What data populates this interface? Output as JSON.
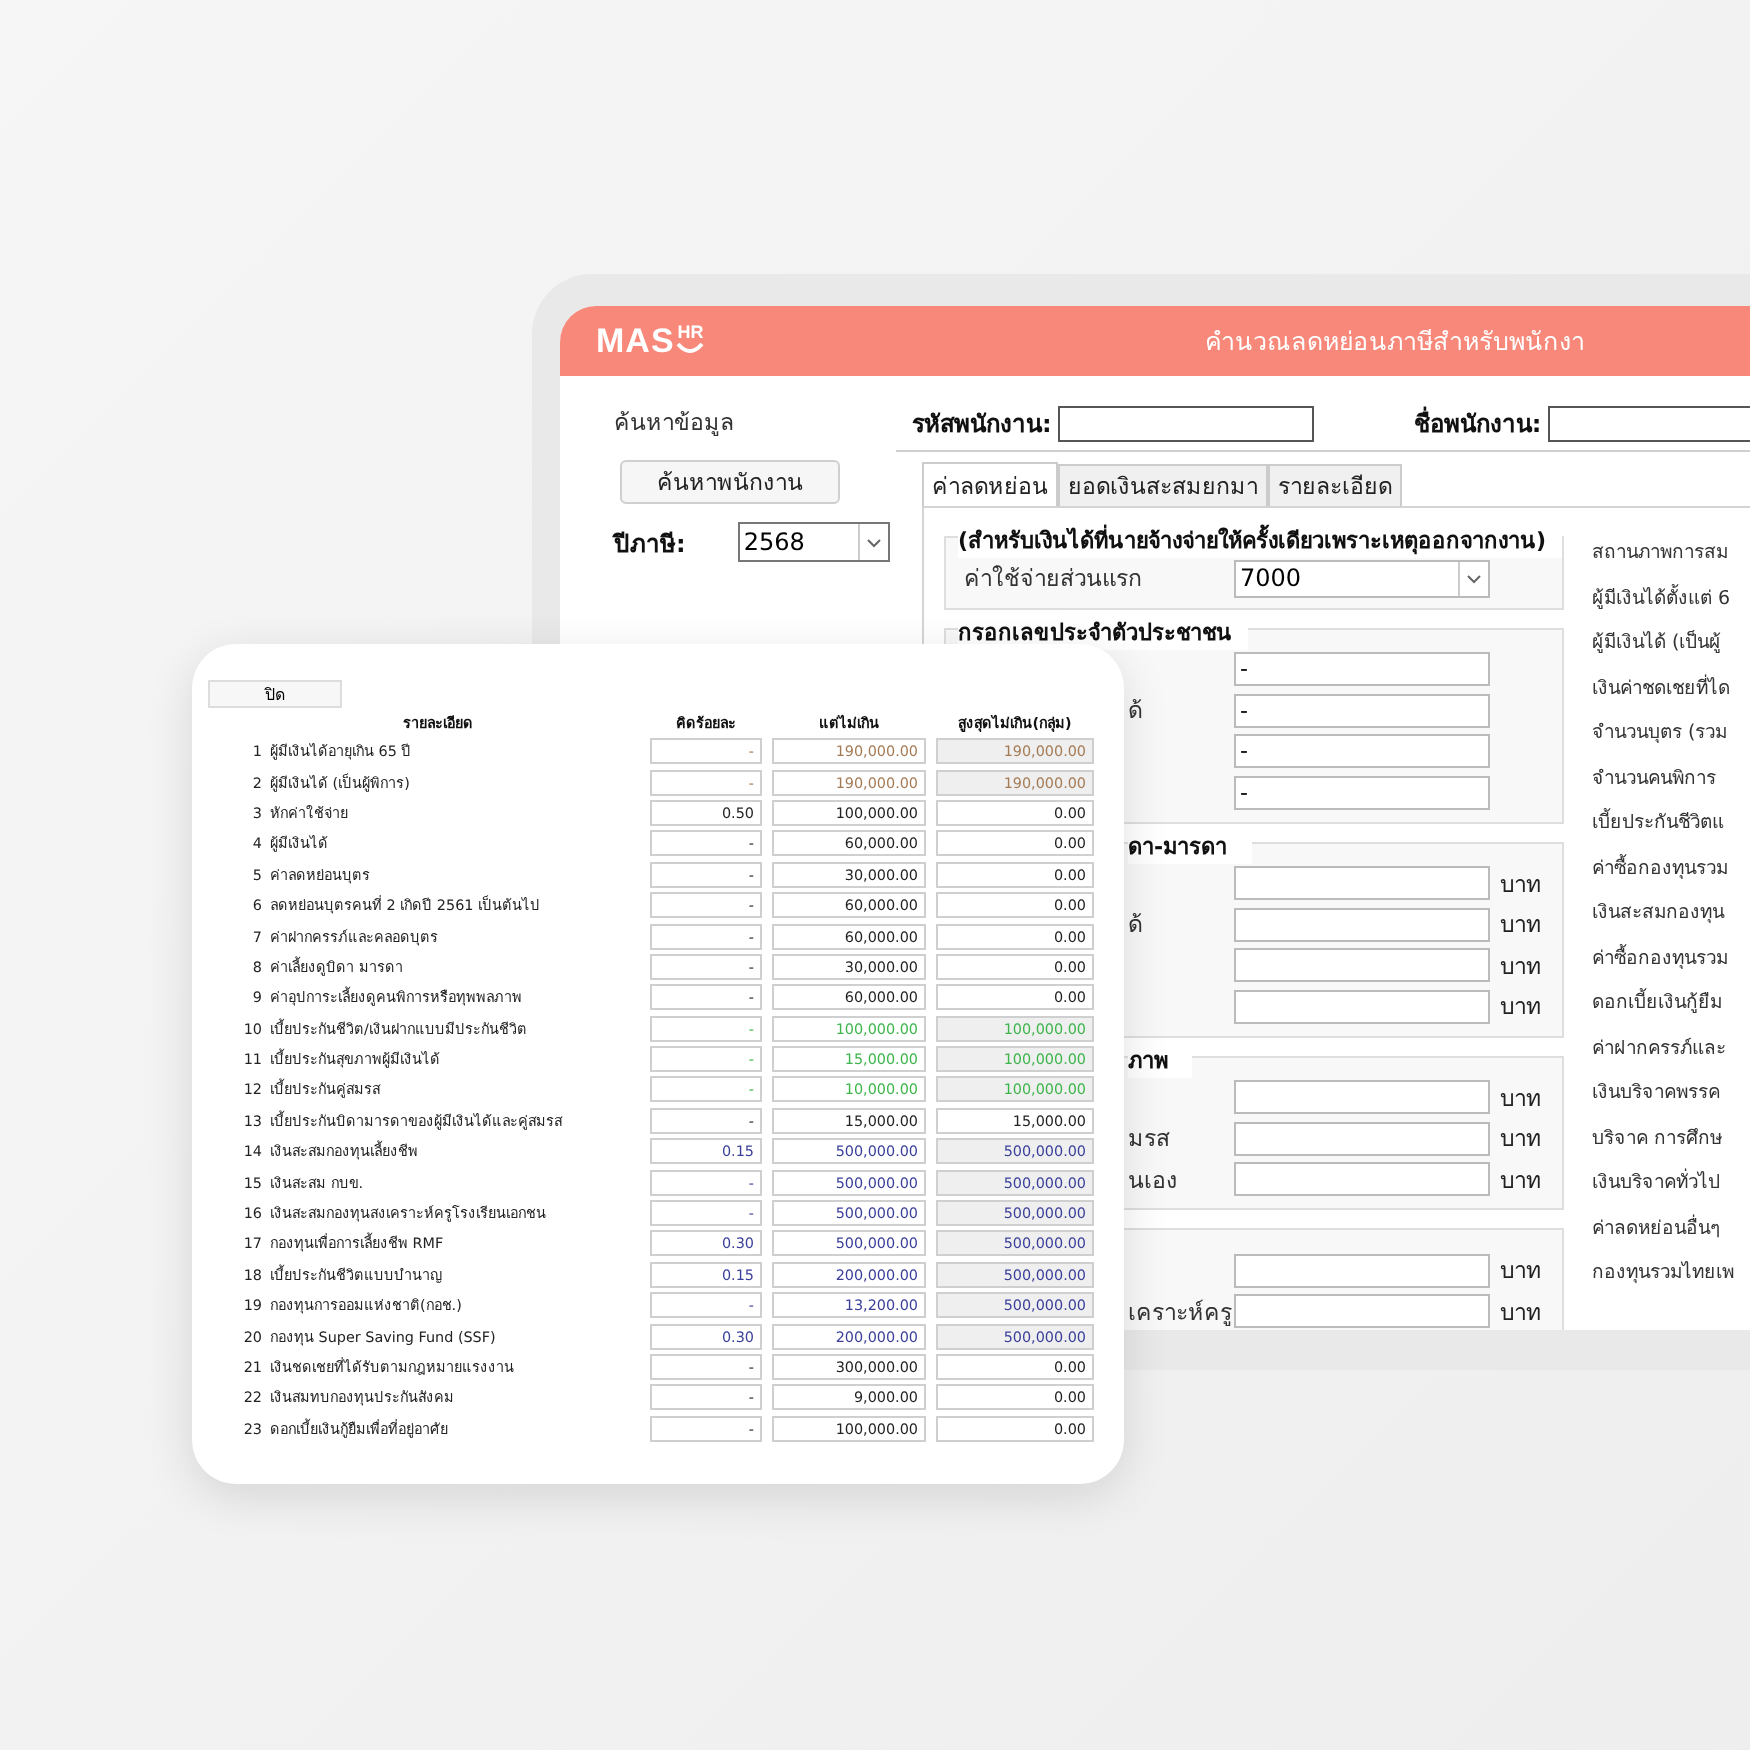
{
  "back_window": {
    "logo": {
      "main": "MAS",
      "sup": "HR"
    },
    "title": "คำนวณลดหย่อนภาษีสำหรับพนักงา",
    "search": {
      "heading": "ค้นหาข้อมูล",
      "button": "ค้นหาพนักงาน",
      "year_label": "ปีภาษี:",
      "year_value": "2568"
    },
    "employee_id_label": "รหัสพนักงาน:",
    "employee_name_label": "ชื่อพนักงาน:",
    "tabs": [
      {
        "label": "ค่าลดหย่อน",
        "selected": true
      },
      {
        "label": "ยอดเงินสะสมยกมา",
        "selected": false
      },
      {
        "label": "รายละเอียด",
        "selected": false
      }
    ],
    "groups": [
      {
        "title": "(สำหรับเงินได้ที่นายจ้างจ่ายให้ครั้งเดียวเพราะเหตุออกจากงาน)",
        "title_cut": false,
        "label_cut": false,
        "rows": [
          {
            "kind": "dropdown",
            "label": "ค่าใช้จ่ายส่วนแรก",
            "value": "7000"
          }
        ]
      },
      {
        "title": "กรอกเลขประจำตัวประชาชน",
        "title_cut": false,
        "label_cut": true,
        "rows": [
          {
            "kind": "input",
            "value": "-"
          },
          {
            "kind": "input",
            "label": "ด้",
            "value": "-"
          },
          {
            "kind": "input",
            "value": "-"
          },
          {
            "kind": "input",
            "value": "-"
          }
        ]
      },
      {
        "title": "ดา-มารดา",
        "title_cut": true,
        "label_cut": true,
        "rows": [
          {
            "kind": "input",
            "unit": "บาท"
          },
          {
            "kind": "input",
            "label": "ด้",
            "unit": "บาท"
          },
          {
            "kind": "input",
            "unit": "บาท"
          },
          {
            "kind": "input",
            "unit": "บาท"
          }
        ]
      },
      {
        "title": "ภาพ",
        "title_cut": true,
        "label_cut": true,
        "rows": [
          {
            "kind": "input",
            "unit": "บาท"
          },
          {
            "kind": "input",
            "label": "มรส",
            "unit": "บาท"
          },
          {
            "kind": "input",
            "label": "นเอง",
            "unit": "บาท"
          }
        ]
      },
      {
        "label_cut": true,
        "rows": [
          {
            "kind": "input",
            "unit": "บาท"
          },
          {
            "kind": "input",
            "label": "เคราะห์ครู",
            "unit": "บาท"
          }
        ]
      }
    ],
    "summary_labels": [
      "สถานภาพการสม",
      "ผู้มีเงินได้ตั้งแต่ 6",
      "ผู้มีเงินได้ (เป็นผู้",
      "เงินค่าชดเชยที่ได",
      "จำนวนบุตร (รวม",
      "จำนวนคนพิการ",
      "เบี้ยประกันชีวิตแ",
      "ค่าซื้อกองทุนรวม",
      "เงินสะสมกองทุน",
      "ค่าซื้อกองทุนรวม",
      "ดอกเบี้ยเงินกู้ยืม",
      "ค่าฝากครรภ์และ",
      "เงินบริจาคพรรค",
      "บริจาค การศึกษ",
      "เงินบริจาคทั่วไป",
      "ค่าลดหย่อนอื่นๆ",
      "กองทุนรวมไทยเพ"
    ]
  },
  "detail_card": {
    "close_button": "ปิด",
    "columns": [
      "รายละเอียด",
      "คิดร้อยละ",
      "แต่ไม่เกิน",
      "สูงสุดไม่เกิน(กลุ่ม)"
    ],
    "rows": [
      {
        "no": "1",
        "label": "ผู้มีเงินได้อายุเกิน 65 ปี",
        "percent": "-",
        "limit": "190,000.00",
        "max": "190,000.00",
        "color": "#a47a55",
        "max_shaded": true
      },
      {
        "no": "2",
        "label": "ผู้มีเงินได้ (เป็นผู้พิการ)",
        "percent": "-",
        "limit": "190,000.00",
        "max": "190,000.00",
        "color": "#a47a55",
        "max_shaded": true
      },
      {
        "no": "3",
        "label": "หักค่าใช้จ่าย",
        "percent": "0.50",
        "limit": "100,000.00",
        "max": "0.00",
        "color": "#222222",
        "max_shaded": false
      },
      {
        "no": "4",
        "label": "ผู้มีเงินได้",
        "percent": "-",
        "limit": "60,000.00",
        "max": "0.00",
        "color": "#222222",
        "max_shaded": false
      },
      {
        "no": "5",
        "label": "ค่าลดหย่อนบุตร",
        "percent": "-",
        "limit": "30,000.00",
        "max": "0.00",
        "color": "#222222",
        "max_shaded": false
      },
      {
        "no": "6",
        "label": "ลดหย่อนบุตรคนที่ 2 เกิดปี 2561 เป็นต้นไป",
        "percent": "-",
        "limit": "60,000.00",
        "max": "0.00",
        "color": "#222222",
        "max_shaded": false
      },
      {
        "no": "7",
        "label": "ค่าฝากครรภ์และคลอดบุตร",
        "percent": "-",
        "limit": "60,000.00",
        "max": "0.00",
        "color": "#222222",
        "max_shaded": false
      },
      {
        "no": "8",
        "label": "ค่าเลี้ยงดูบิดา มารดา",
        "percent": "-",
        "limit": "30,000.00",
        "max": "0.00",
        "color": "#222222",
        "max_shaded": false
      },
      {
        "no": "9",
        "label": "ค่าอุปการะเลี้ยงดูคนพิการหรือทุพพลภาพ",
        "percent": "-",
        "limit": "60,000.00",
        "max": "0.00",
        "color": "#222222",
        "max_shaded": false
      },
      {
        "no": "10",
        "label": "เบี้ยประกันชีวิต/เงินฝากแบบมีประกันชีวิต",
        "percent": "-",
        "limit": "100,000.00",
        "max": "100,000.00",
        "color": "#3cb54a",
        "max_shaded": true
      },
      {
        "no": "11",
        "label": "เบี้ยประกันสุขภาพผู้มีเงินได้",
        "percent": "-",
        "limit": "15,000.00",
        "max": "100,000.00",
        "color": "#3cb54a",
        "max_shaded": true
      },
      {
        "no": "12",
        "label": "เบี้ยประกันคู่สมรส",
        "percent": "-",
        "limit": "10,000.00",
        "max": "100,000.00",
        "color": "#3cb54a",
        "max_shaded": true
      },
      {
        "no": "13",
        "label": "เบี้ยประกันบิดามารดาของผู้มีเงินได้และคู่สมรส",
        "percent": "-",
        "limit": "15,000.00",
        "max": "15,000.00",
        "color": "#222222",
        "max_shaded": false
      },
      {
        "no": "14",
        "label": "เงินสะสมกองทุนเลี้ยงชีพ",
        "percent": "0.15",
        "limit": "500,000.00",
        "max": "500,000.00",
        "color": "#3a3f9a",
        "max_shaded": true
      },
      {
        "no": "15",
        "label": "เงินสะสม กบข.",
        "percent": "-",
        "limit": "500,000.00",
        "max": "500,000.00",
        "color": "#3a3f9a",
        "max_shaded": true
      },
      {
        "no": "16",
        "label": "เงินสะสมกองทุนสงเคราะห์ครูโรงเรียนเอกชน",
        "percent": "-",
        "limit": "500,000.00",
        "max": "500,000.00",
        "color": "#3a3f9a",
        "max_shaded": true
      },
      {
        "no": "17",
        "label": "กองทุนเพื่อการเลี้ยงชีพ RMF",
        "percent": "0.30",
        "limit": "500,000.00",
        "max": "500,000.00",
        "color": "#3a3f9a",
        "max_shaded": true
      },
      {
        "no": "18",
        "label": "เบี้ยประกันชีวิตแบบบำนาญ",
        "percent": "0.15",
        "limit": "200,000.00",
        "max": "500,000.00",
        "color": "#3a3f9a",
        "max_shaded": true
      },
      {
        "no": "19",
        "label": "กองทุนการออมแห่งชาติ(กอช.)",
        "percent": "-",
        "limit": "13,200.00",
        "max": "500,000.00",
        "color": "#3a3f9a",
        "max_shaded": true
      },
      {
        "no": "20",
        "label": "กองทุน Super Saving Fund (SSF)",
        "percent": "0.30",
        "limit": "200,000.00",
        "max": "500,000.00",
        "color": "#3a3f9a",
        "max_shaded": true
      },
      {
        "no": "21",
        "label": "เงินชดเชยที่ได้รับตามกฎหมายแรงงาน",
        "percent": "-",
        "limit": "300,000.00",
        "max": "0.00",
        "color": "#222222",
        "max_shaded": false
      },
      {
        "no": "22",
        "label": "เงินสมทบกองทุนประกันสังคม",
        "percent": "-",
        "limit": "9,000.00",
        "max": "0.00",
        "color": "#222222",
        "max_shaded": false
      },
      {
        "no": "23",
        "label": "ดอกเบี้ยเงินกู้ยืมเพื่อที่อยู่อาศัย",
        "percent": "-",
        "limit": "100,000.00",
        "max": "0.00",
        "color": "#222222",
        "max_shaded": false
      }
    ]
  }
}
